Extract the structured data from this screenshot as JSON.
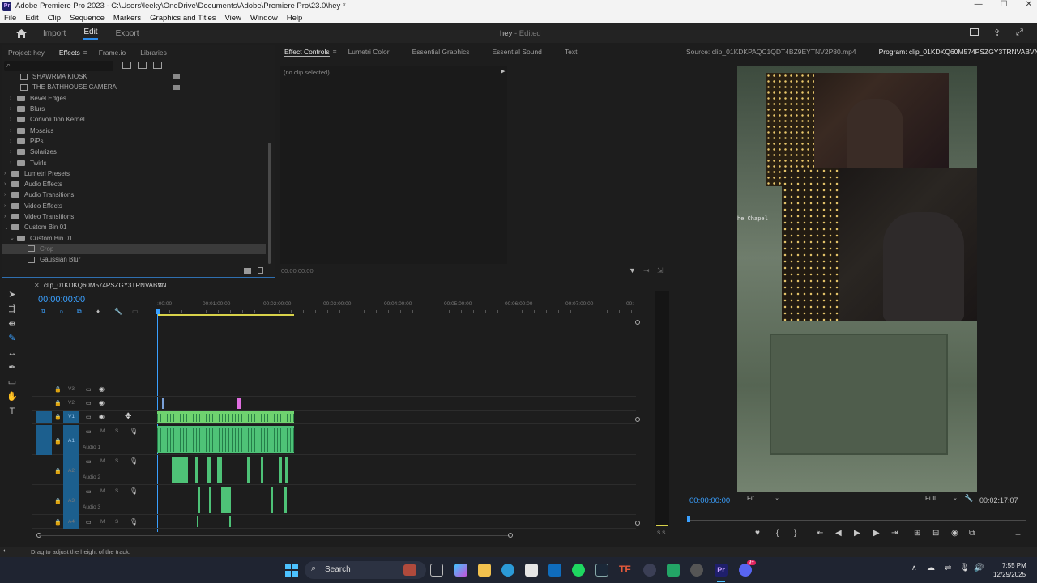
{
  "window": {
    "title": "Adobe Premiere Pro 2023 - C:\\Users\\leeky\\OneDrive\\Documents\\Adobe\\Premiere Pro\\23.0\\hey *",
    "menu": [
      "File",
      "Edit",
      "Clip",
      "Sequence",
      "Markers",
      "Graphics and Titles",
      "View",
      "Window",
      "Help"
    ]
  },
  "header": {
    "tabs": [
      "Import",
      "Edit",
      "Export"
    ],
    "active_tab": "Edit",
    "project_name": "hey",
    "project_status": "- Edited"
  },
  "effects_panel": {
    "tabs": [
      "Project: hey",
      "Effects",
      "Frame.io",
      "Libraries"
    ],
    "active_tab": "Effects",
    "tree": [
      {
        "label": "SHAWRMA KIOSK",
        "kind": "preset",
        "indent": 2
      },
      {
        "label": "THE BATHHOUSE CAMERA",
        "kind": "preset",
        "indent": 2
      },
      {
        "label": "Bevel Edges",
        "kind": "folder",
        "indent": 1
      },
      {
        "label": "Blurs",
        "kind": "folder",
        "indent": 1
      },
      {
        "label": "Convolution Kernel",
        "kind": "folder",
        "indent": 1
      },
      {
        "label": "Mosaics",
        "kind": "folder",
        "indent": 1
      },
      {
        "label": "PiPs",
        "kind": "folder",
        "indent": 1
      },
      {
        "label": "Solarizes",
        "kind": "folder",
        "indent": 1
      },
      {
        "label": "Twirls",
        "kind": "folder",
        "indent": 1
      },
      {
        "label": "Lumetri Presets",
        "kind": "folder",
        "indent": 0
      },
      {
        "label": "Audio Effects",
        "kind": "folder",
        "indent": 0
      },
      {
        "label": "Audio Transitions",
        "kind": "folder",
        "indent": 0
      },
      {
        "label": "Video Effects",
        "kind": "folder",
        "indent": 0
      },
      {
        "label": "Video Transitions",
        "kind": "folder",
        "indent": 0
      },
      {
        "label": "Custom Bin 01",
        "kind": "folder",
        "indent": 0
      },
      {
        "label": "Custom Bin 01",
        "kind": "folder",
        "indent": 1
      },
      {
        "label": "Crop",
        "kind": "effect",
        "indent": 2
      },
      {
        "label": "Gaussian Blur",
        "kind": "effect",
        "indent": 2
      }
    ]
  },
  "effect_controls": {
    "tabs": [
      "Effect Controls",
      "Lumetri Color",
      "Essential Graphics",
      "Essential Sound",
      "Text"
    ],
    "active_tab": "Effect Controls",
    "no_clip": "(no clip selected)",
    "timecode": "00:00:00:00"
  },
  "monitor": {
    "source_tab": "Source: clip_01KDKPAQC1QDT4BZ9EYTNV2P80.mp4",
    "program_tab": "Program: clip_01KDKQ60M574PSZGY3TRNVABVN",
    "overlay_text": "he Chapel",
    "timecode": "00:00:00:00",
    "fit": "Fit",
    "quality": "Full",
    "duration": "00:02:17:07"
  },
  "timeline": {
    "sequence_name": "clip_01KDKQ60M574PSZGY3TRNVABVN",
    "timecode": "00:00:00:00",
    "ruler": [
      ":00:00",
      "00:01:00:00",
      "00:02:00:00",
      "00:03:00:00",
      "00:04:00:00",
      "00:05:00:00",
      "00:06:00:00",
      "00:07:00:00",
      "00:"
    ],
    "video_tracks": [
      "V3",
      "V2",
      "V1"
    ],
    "audio_tracks": [
      {
        "id": "A1",
        "name": "Audio 1"
      },
      {
        "id": "A2",
        "name": "Audio 2"
      },
      {
        "id": "A3",
        "name": "Audio 3"
      },
      {
        "id": "A4",
        "name": ""
      }
    ],
    "m": "M",
    "s": "S",
    "meter_label": "S S"
  },
  "status": {
    "text": "Drag to adjust the height of the track."
  },
  "taskbar": {
    "search_label": "Search",
    "time": "7:55 PM",
    "date": "12/29/2025",
    "badge": "9+"
  },
  "colors": {
    "accent": "#2d8ceb",
    "clip_video": "#6fd36f",
    "clip_audio": "#4ec277",
    "playhead": "#3aa0ff"
  }
}
